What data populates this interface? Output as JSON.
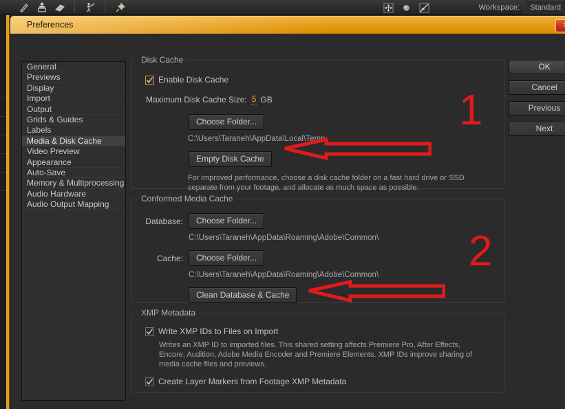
{
  "app": {
    "workspace_label": "Workspace:",
    "workspace_value": "Standard",
    "toolbar_icons": [
      "pen-tool-icon",
      "clone-stamp-icon",
      "eraser-icon",
      "brush-person-icon",
      "pin-icon",
      "move-icon",
      "sphere-icon",
      "no-image-icon"
    ]
  },
  "window": {
    "title": "Preferences",
    "close_label": "✕"
  },
  "sidebar": {
    "items": [
      {
        "label": "General",
        "selected": false
      },
      {
        "label": "Previews",
        "selected": false
      },
      {
        "label": "Display",
        "selected": false
      },
      {
        "label": "Import",
        "selected": false
      },
      {
        "label": "Output",
        "selected": false
      },
      {
        "label": "Grids & Guides",
        "selected": false
      },
      {
        "label": "Labels",
        "selected": false
      },
      {
        "label": "Media & Disk Cache",
        "selected": true
      },
      {
        "label": "Video Preview",
        "selected": false
      },
      {
        "label": "Appearance",
        "selected": false
      },
      {
        "label": "Auto-Save",
        "selected": false
      },
      {
        "label": "Memory & Multiprocessing",
        "selected": false
      },
      {
        "label": "Audio Hardware",
        "selected": false
      },
      {
        "label": "Audio Output Mapping",
        "selected": false
      }
    ]
  },
  "disk_cache": {
    "group_title": "Disk Cache",
    "enable_label": "Enable Disk Cache",
    "enable_checked": true,
    "max_size_label": "Maximum Disk Cache Size:",
    "max_size_value": "5",
    "max_size_unit": "GB",
    "choose_folder_label": "Choose Folder...",
    "folder_path": "C:\\Users\\Taraneh\\AppData\\Local\\Temp",
    "empty_cache_label": "Empty Disk Cache",
    "hint": "For improved performance, choose a disk cache folder on a fast hard drive or SSD separate from your footage, and allocate as much space as possible."
  },
  "conformed_media_cache": {
    "group_title": "Conformed Media Cache",
    "database_label": "Database:",
    "database_button": "Choose Folder...",
    "database_path": "C:\\Users\\Taraneh\\AppData\\Roaming\\Adobe\\Common\\",
    "cache_label": "Cache:",
    "cache_button": "Choose Folder...",
    "cache_path": "C:\\Users\\Taraneh\\AppData\\Roaming\\Adobe\\Common\\",
    "clean_label": "Clean Database & Cache"
  },
  "xmp_metadata": {
    "group_title": "XMP Metadata",
    "write_ids_label": "Write XMP IDs to Files on Import",
    "write_ids_checked": true,
    "write_ids_hint": "Writes an XMP ID to imported files. This shared setting affects Premiere Pro, After Effects, Encore, Audition, Adobe Media Encoder and Premiere Elements. XMP IDs improve sharing of media cache files and previews.",
    "layer_markers_label": "Create Layer Markers from Footage XMP Metadata",
    "layer_markers_checked": true
  },
  "actions": {
    "ok": "OK",
    "cancel": "Cancel",
    "previous": "Previous",
    "next": "Next"
  },
  "annotations": {
    "marker_one": "1",
    "marker_two": "2",
    "color": "#e01b1b"
  }
}
